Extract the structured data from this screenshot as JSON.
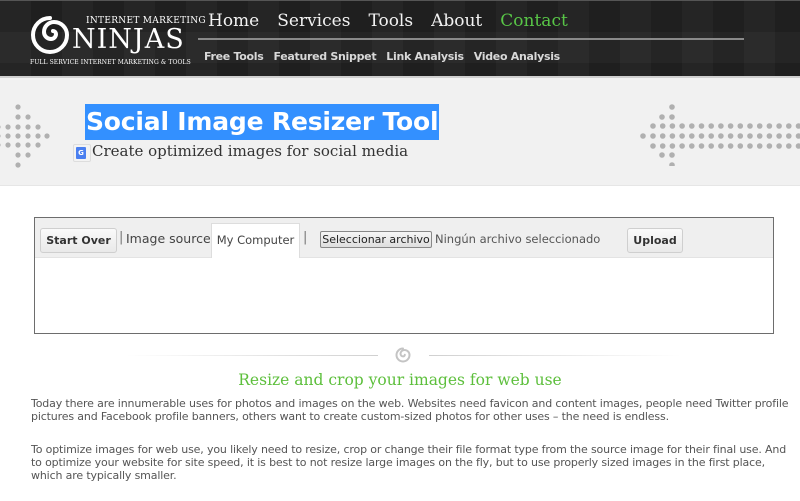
{
  "header": {
    "logo": {
      "top_text": "INTERNET MARKETING",
      "main_text": "NINJAS",
      "sub_text": "FULL SERVICE INTERNET MARKETING & TOOLS"
    },
    "main_nav": [
      {
        "label": "Home",
        "active": false
      },
      {
        "label": "Services",
        "active": false
      },
      {
        "label": "Tools",
        "active": false
      },
      {
        "label": "About",
        "active": false
      },
      {
        "label": "Contact",
        "active": true
      }
    ],
    "sub_nav": [
      {
        "label": "Free Tools"
      },
      {
        "label": "Featured Snippet"
      },
      {
        "label": "Link Analysis"
      },
      {
        "label": "Video Analysis"
      }
    ]
  },
  "hero": {
    "title": "Social Image Resizer Tool",
    "subtitle": "Create optimized images for social media"
  },
  "tool": {
    "start_over_label": "Start Over",
    "separator": "|",
    "image_source_label": "Image source:",
    "source_tab_label": "My Computer",
    "file_button_label": "Seleccionar archivo",
    "file_status": "Ningún archivo seleccionado",
    "upload_label": "Upload"
  },
  "content": {
    "section_title": "Resize and crop your images for web use",
    "paragraphs": [
      "Today there are innumerable uses for photos and images on the web. Websites need favicon and content images, people need Twitter profile pictures and Facebook profile banners, others want to create custom-sized photos for other uses – the need is endless.",
      "To optimize images for web use, you likely need to resize, crop or change their file format type from the source image for their final use. And to optimize your website for site speed, it is best to not resize large images on the fly, but to use properly sized images in the first place, which are typically smaller."
    ]
  },
  "colors": {
    "accent_green": "#58c547",
    "selection_blue": "#3390ff",
    "header_bg": "#232323"
  },
  "icons": {
    "logo": "swirl-icon",
    "divider": "swirl-icon",
    "translate": "google-translate-icon",
    "hero_left": "dot-arrow-icon",
    "hero_right": "dot-arrow-left-icon"
  }
}
